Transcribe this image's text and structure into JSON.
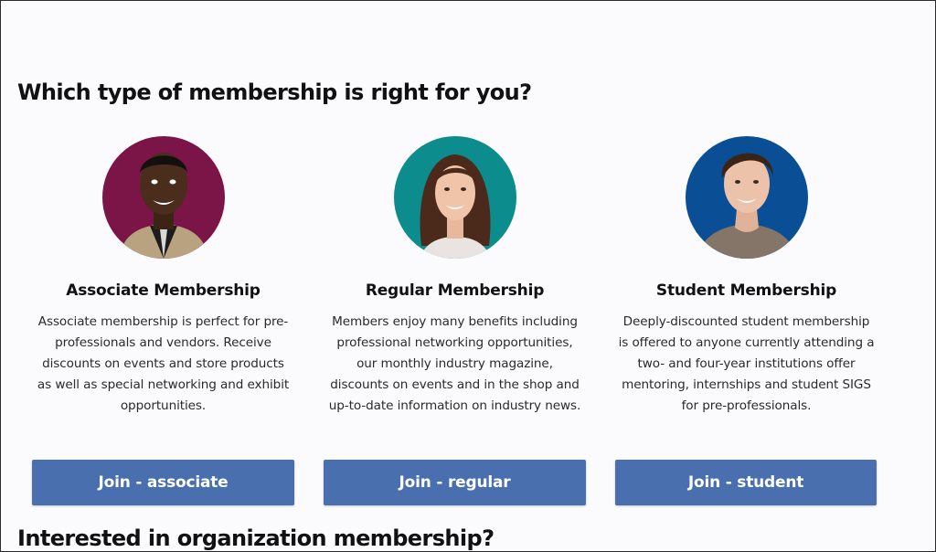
{
  "heading": "Which type of membership is right for you?",
  "cards": [
    {
      "title": "Associate Membership",
      "description": "Associate membership is perfect for pre-professionals and vendors. Receive discounts on events and store products as well as special networking and exhibit opportunities.",
      "button": "Join - associate",
      "avatar_bg": "#7b1447"
    },
    {
      "title": "Regular Membership",
      "description": "Members enjoy many benefits including professional networking opportunities, our monthly industry magazine, discounts on events and in the shop and up-to-date information on industry news.",
      "button": "Join - regular",
      "avatar_bg": "#0c8c8c"
    },
    {
      "title": "Student Membership",
      "description": "Deeply-discounted student membership is offered to anyone currently attending a two- and four-year institutions offer mentoring, internships and student SIGS for pre-professionals.",
      "button": "Join - student",
      "avatar_bg": "#0a4e96"
    }
  ],
  "next_heading": "Interested in organization membership?",
  "colors": {
    "button_bg": "#4a6fae",
    "page_bg": "#fbfbfe"
  }
}
